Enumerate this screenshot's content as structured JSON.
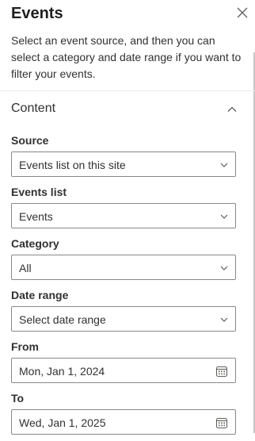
{
  "panel": {
    "title": "Events",
    "description": "Select an event source, and then you can select a category and date range if you want to filter your events.",
    "close_icon": "close-icon"
  },
  "section": {
    "title": "Content",
    "icon": "chevron-up-icon"
  },
  "fields": {
    "source": {
      "label": "Source",
      "value": "Events list on this site"
    },
    "events_list": {
      "label": "Events list",
      "value": "Events"
    },
    "category": {
      "label": "Category",
      "value": "All"
    },
    "date_range": {
      "label": "Date range",
      "value": "Select date range"
    },
    "from": {
      "label": "From",
      "value": "Mon, Jan 1, 2024"
    },
    "to": {
      "label": "To",
      "value": "Wed, Jan 1, 2025"
    }
  },
  "icons": {
    "dropdown": "chevron-down-icon",
    "date_picker": "calendar-icon"
  }
}
